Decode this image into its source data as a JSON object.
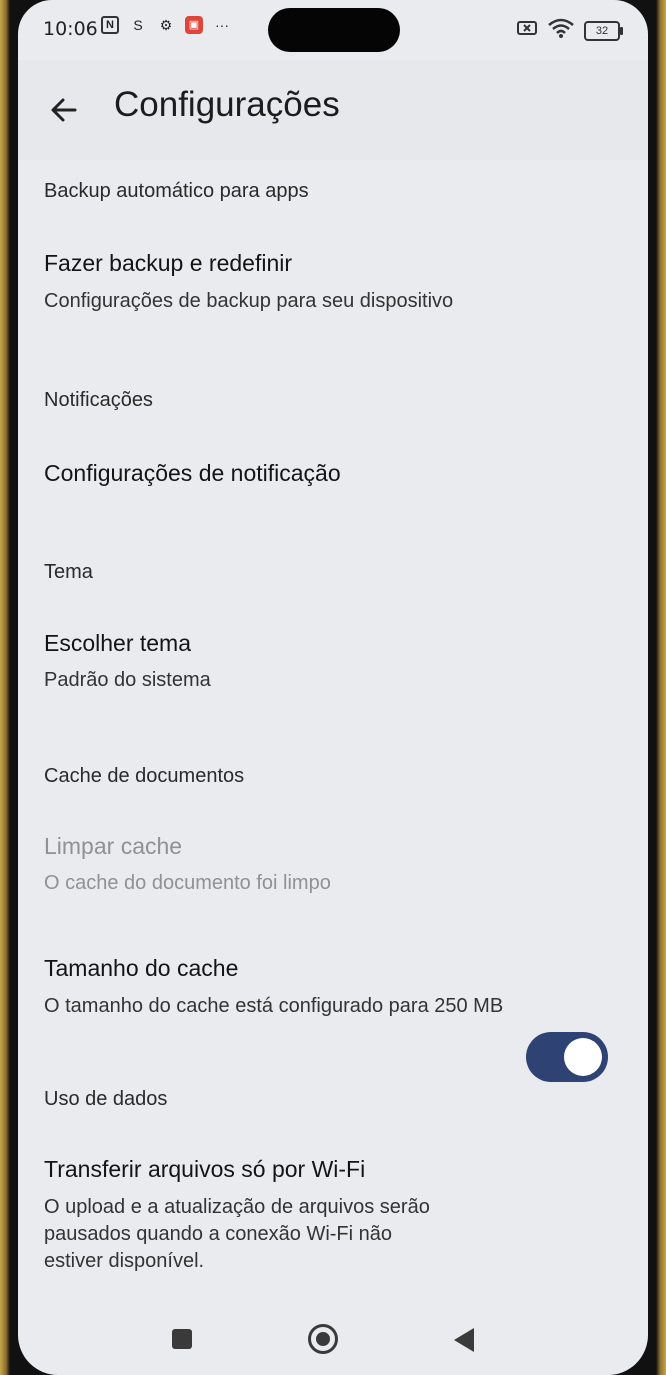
{
  "status_bar": {
    "time": "10:06",
    "nfc_glyph": "N",
    "s_glyph": "S",
    "more": "···",
    "battery": "32"
  },
  "app_bar": {
    "title": "Configurações"
  },
  "sections": {
    "backup": {
      "header": "Backup automático para apps",
      "item_title": "Fazer backup e redefinir",
      "item_subtitle": "Configurações de backup para seu dispositivo"
    },
    "notifications": {
      "header": "Notificações",
      "item_title": "Configurações de notificação"
    },
    "theme": {
      "header": "Tema",
      "item_title": "Escolher tema",
      "item_subtitle": "Padrão do sistema"
    },
    "cache": {
      "header": "Cache de documentos",
      "clear_title": "Limpar cache",
      "clear_subtitle": "O cache do documento foi limpo",
      "size_title": "Tamanho do cache",
      "size_subtitle": "O tamanho do cache está configurado para 250 MB"
    },
    "data_usage": {
      "header": "Uso de dados",
      "wifi_title": "Transferir arquivos só por Wi-Fi",
      "wifi_subtitle_line1": "O upload e a atualização de arquivos serão",
      "wifi_subtitle_line2": "pausados quando a conexão Wi-Fi não",
      "wifi_subtitle_line3": "estiver disponível.",
      "wifi_toggle_on": true
    }
  },
  "colors": {
    "background": "#e9ebee",
    "toggle_track": "#2e4374",
    "disabled_text": "#8e9196"
  }
}
